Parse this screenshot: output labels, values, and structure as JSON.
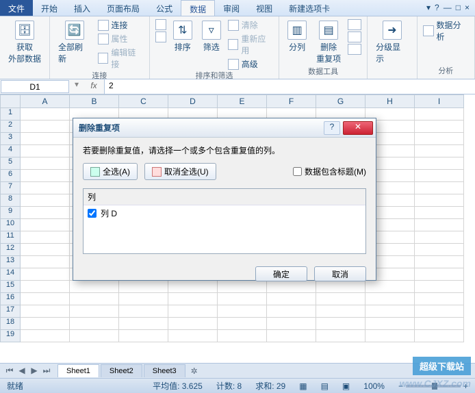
{
  "tabs": {
    "file": "文件",
    "items": [
      "开始",
      "插入",
      "页面布局",
      "公式",
      "数据",
      "审阅",
      "视图",
      "新建选项卡"
    ],
    "active_index": 4
  },
  "titlebar": {
    "help": "?",
    "min": "—",
    "max": "□",
    "close": "×",
    "rmin": "▾",
    "rmax": "▣"
  },
  "ribbon": {
    "g1": {
      "btn1": "获取\n外部数据",
      "label": ""
    },
    "g2": {
      "btn1": "全部刷新",
      "s1": "连接",
      "s2": "属性",
      "s3": "编辑链接",
      "label": "连接"
    },
    "g3": {
      "az": "A↓Z",
      "za": "Z↓A",
      "sort": "排序",
      "filter": "筛选",
      "s1": "清除",
      "s2": "重新应用",
      "s3": "高级",
      "label": "排序和筛选"
    },
    "g4": {
      "b1": "分列",
      "b2": "删除\n重复项",
      "label": "数据工具"
    },
    "g5": {
      "b1": "分级显示",
      "label": ""
    },
    "g6": {
      "b1": "数据分析",
      "label": "分析"
    }
  },
  "namebox": {
    "cell": "D1",
    "fx": "fx",
    "value": "2"
  },
  "columns": [
    "A",
    "B",
    "C",
    "D",
    "E",
    "F",
    "G",
    "H",
    "I"
  ],
  "rows": [
    1,
    2,
    3,
    4,
    5,
    6,
    7,
    8,
    9,
    10,
    11,
    12,
    13,
    14,
    15,
    16,
    17,
    18,
    19
  ],
  "dialog": {
    "title": "删除重复项",
    "msg": "若要删除重复值，请选择一个或多个包含重复值的列。",
    "select_all": "全选(A)",
    "unselect_all": "取消全选(U)",
    "has_header": "数据包含标题(M)",
    "has_header_checked": false,
    "list_header": "列",
    "item": {
      "checked": true,
      "label": "列 D"
    },
    "ok": "确定",
    "cancel": "取消",
    "help": "?",
    "close": "✕"
  },
  "sheets": {
    "nav": [
      "⏮",
      "◀",
      "▶",
      "⏭"
    ],
    "tabs": [
      "Sheet1",
      "Sheet2",
      "Sheet3"
    ],
    "add": "+"
  },
  "status": {
    "ready": "就绪",
    "avg_lbl": "平均值:",
    "avg": "3.625",
    "count_lbl": "计数:",
    "count": "8",
    "sum_lbl": "求和:",
    "sum": "29",
    "zoom": "100%",
    "minus": "−",
    "plus": "+"
  },
  "watermark": {
    "badge": "超级下载站",
    "url": "www.CJXZ.com"
  }
}
